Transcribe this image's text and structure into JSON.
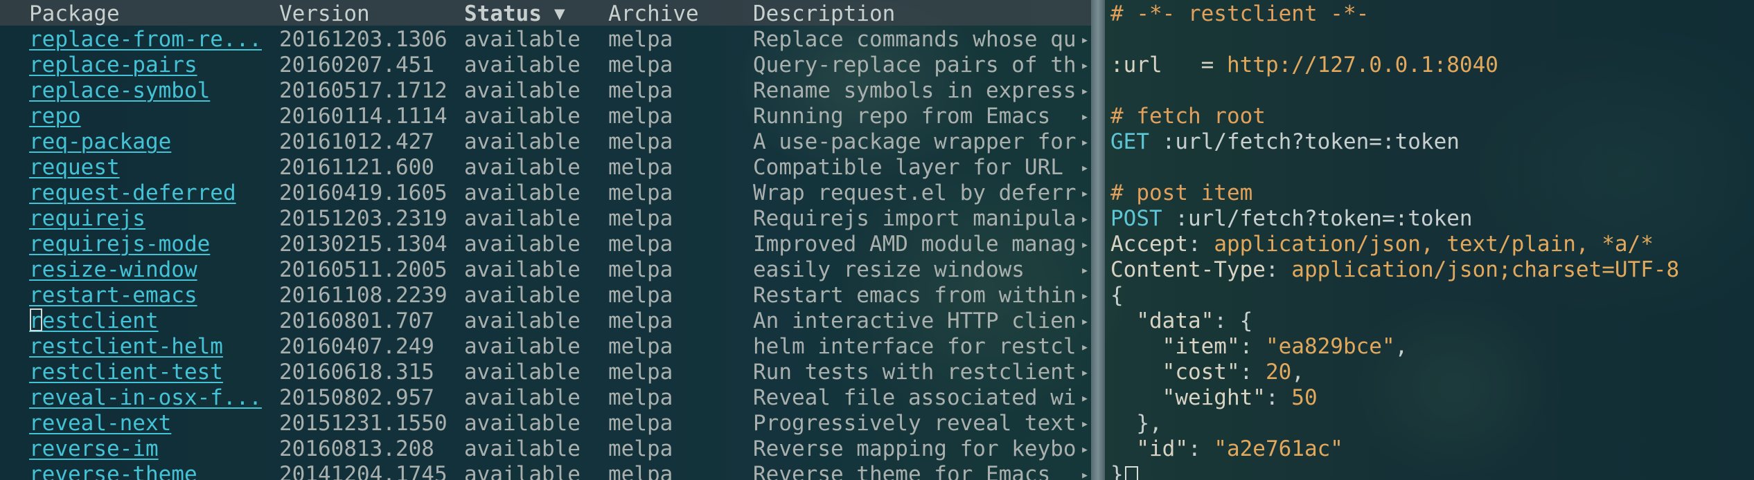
{
  "package_list": {
    "columns": {
      "package": "Package",
      "version": "Version",
      "status": "Status",
      "sort_indicator": "▼",
      "archive": "Archive",
      "description": "Description"
    },
    "continuation_glyph": "▸",
    "rows": [
      {
        "name": "replace-from-re...",
        "version": "20161203.1306",
        "status": "available",
        "archive": "melpa",
        "description": "Replace commands whose qu"
      },
      {
        "name": "replace-pairs",
        "version": "20160207.451",
        "status": "available",
        "archive": "melpa",
        "description": "Query-replace pairs of th"
      },
      {
        "name": "replace-symbol",
        "version": "20160517.1712",
        "status": "available",
        "archive": "melpa",
        "description": "Rename symbols in express"
      },
      {
        "name": "repo",
        "version": "20160114.1114",
        "status": "available",
        "archive": "melpa",
        "description": "Running repo from Emacs"
      },
      {
        "name": "req-package",
        "version": "20161012.427",
        "status": "available",
        "archive": "melpa",
        "description": "A use-package wrapper for"
      },
      {
        "name": "request",
        "version": "20161121.600",
        "status": "available",
        "archive": "melpa",
        "description": "Compatible layer for URL"
      },
      {
        "name": "request-deferred",
        "version": "20160419.1605",
        "status": "available",
        "archive": "melpa",
        "description": "Wrap request.el by deferr"
      },
      {
        "name": "requirejs",
        "version": "20151203.2319",
        "status": "available",
        "archive": "melpa",
        "description": "Requirejs import manipula"
      },
      {
        "name": "requirejs-mode",
        "version": "20130215.1304",
        "status": "available",
        "archive": "melpa",
        "description": "Improved AMD module manag"
      },
      {
        "name": "resize-window",
        "version": "20160511.2005",
        "status": "available",
        "archive": "melpa",
        "description": "easily resize windows"
      },
      {
        "name": "restart-emacs",
        "version": "20161108.2239",
        "status": "available",
        "archive": "melpa",
        "description": "Restart emacs from within"
      },
      {
        "name": "restclient",
        "version": "20160801.707",
        "status": "available",
        "archive": "melpa",
        "description": "An interactive HTTP clien"
      },
      {
        "name": "restclient-helm",
        "version": "20160407.249",
        "status": "available",
        "archive": "melpa",
        "description": "helm interface for restcl"
      },
      {
        "name": "restclient-test",
        "version": "20160618.315",
        "status": "available",
        "archive": "melpa",
        "description": "Run tests with restclient"
      },
      {
        "name": "reveal-in-osx-f...",
        "version": "20150802.957",
        "status": "available",
        "archive": "melpa",
        "description": "Reveal file associated wi"
      },
      {
        "name": "reveal-next",
        "version": "20151231.1550",
        "status": "available",
        "archive": "melpa",
        "description": "Progressively reveal text"
      },
      {
        "name": "reverse-im",
        "version": "20160813.208",
        "status": "available",
        "archive": "melpa",
        "description": "Reverse mapping for keybo"
      },
      {
        "name": "reverse-theme",
        "version": "20141204.1745",
        "status": "available",
        "archive": "melpa",
        "description": "Reverse theme for Emacs"
      }
    ]
  },
  "restclient_buffer": {
    "header_comment": "# -*- restclient -*-",
    "url_var": ":url",
    "url_eq": "   = ",
    "url_value": "http://127.0.0.1:8040",
    "comment_fetch": "# fetch root",
    "get_method": "GET",
    "get_path": " :url/fetch?token=:token",
    "comment_post": "# post item",
    "post_method": "POST",
    "post_path": " :url/fetch?token=:token",
    "accept_key": "Accept",
    "accept_value": " application/json, text/plain, *a/*",
    "ctype_key": "Content-Type",
    "ctype_value": " application/json;charset=UTF-8",
    "open_brace": "{",
    "data_key": "  \"data\"",
    "data_open": ": {",
    "item_key": "    \"item\"",
    "item_sep": ": ",
    "item_val": "\"ea829bce\"",
    "item_comma": ",",
    "cost_key": "    \"cost\"",
    "cost_sep": ": ",
    "cost_val": "20",
    "cost_comma": ",",
    "weight_key": "    \"weight\"",
    "weight_sep": ": ",
    "weight_val": "50",
    "data_close": "  },",
    "id_key": "  \"id\"",
    "id_sep": ": ",
    "id_val": "\"a2e761ac\"",
    "close_brace": "}"
  }
}
